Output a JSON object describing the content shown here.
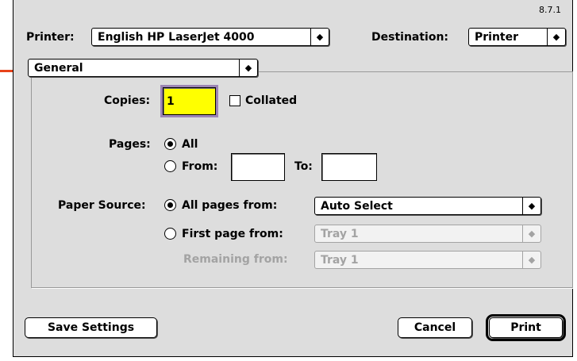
{
  "version": "8.7.1",
  "printer": {
    "label": "Printer:",
    "value": "English HP LaserJet 4000"
  },
  "destination": {
    "label": "Destination:",
    "value": "Printer"
  },
  "panel": {
    "value": "General"
  },
  "copies": {
    "label": "Copies:",
    "value": "1",
    "collated_label": "Collated",
    "collated_checked": false
  },
  "pages": {
    "label": "Pages:",
    "all_label": "All",
    "from_label": "From:",
    "to_label": "To:",
    "from_value": "",
    "to_value": ""
  },
  "paper_source": {
    "label": "Paper Source:",
    "all_pages_label": "All pages from:",
    "all_pages_value": "Auto Select",
    "first_page_label": "First page from:",
    "first_page_value": "Tray 1",
    "remaining_label": "Remaining from:",
    "remaining_value": "Tray 1"
  },
  "buttons": {
    "save": "Save Settings",
    "cancel": "Cancel",
    "print": "Print"
  },
  "colors": {
    "focus_field": "#ffff00",
    "focus_ring": "#9c84b4",
    "dialog_bg": "#dddddd",
    "pointer_line": "#e8431a"
  }
}
